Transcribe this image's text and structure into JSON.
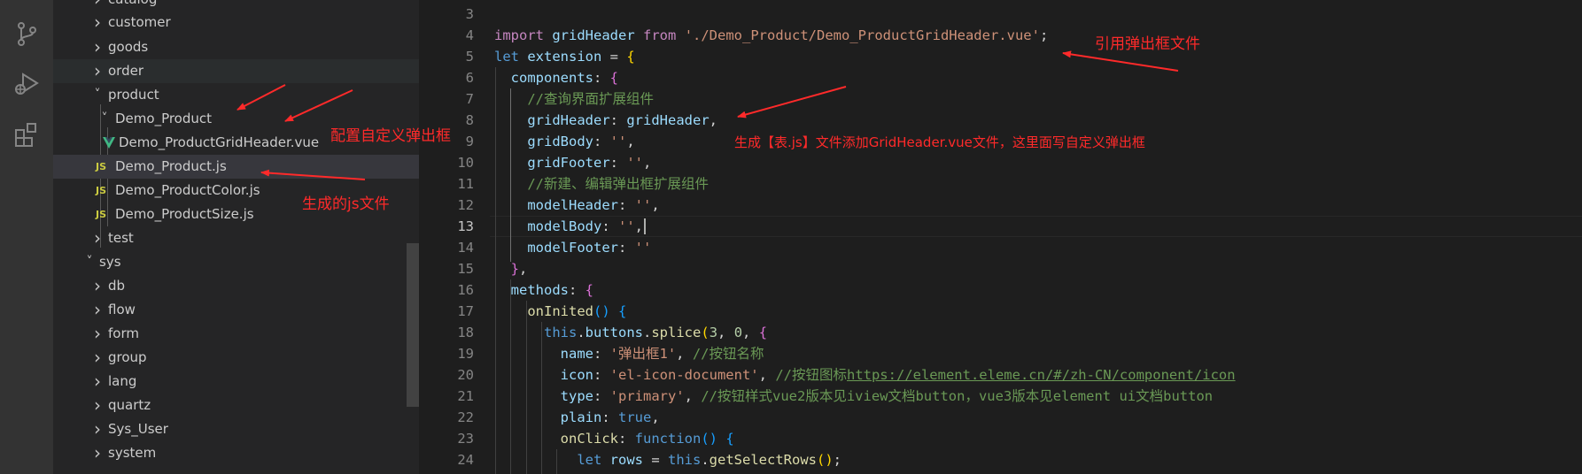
{
  "explorer": {
    "items": [
      {
        "label": "catalog",
        "type": "folder",
        "open": false
      },
      {
        "label": "customer",
        "type": "folder",
        "open": false
      },
      {
        "label": "goods",
        "type": "folder",
        "open": false
      },
      {
        "label": "order",
        "type": "folder",
        "open": false
      },
      {
        "label": "product",
        "type": "folder",
        "open": true
      },
      {
        "label": "Demo_Product",
        "type": "folder",
        "open": true
      },
      {
        "label": "Demo_ProductGridHeader.vue",
        "type": "vue"
      },
      {
        "label": "Demo_Product.js",
        "type": "js"
      },
      {
        "label": "Demo_ProductColor.js",
        "type": "js"
      },
      {
        "label": "Demo_ProductSize.js",
        "type": "js"
      },
      {
        "label": "test",
        "type": "folder",
        "open": false
      },
      {
        "label": "sys",
        "type": "folder",
        "open": true
      },
      {
        "label": "db",
        "type": "folder",
        "open": false
      },
      {
        "label": "flow",
        "type": "folder",
        "open": false
      },
      {
        "label": "form",
        "type": "folder",
        "open": false
      },
      {
        "label": "group",
        "type": "folder",
        "open": false
      },
      {
        "label": "lang",
        "type": "folder",
        "open": false
      },
      {
        "label": "quartz",
        "type": "folder",
        "open": false
      },
      {
        "label": "Sys_User",
        "type": "folder",
        "open": false
      },
      {
        "label": "system",
        "type": "folder",
        "open": false
      }
    ]
  },
  "icons": {
    "js_badge": "JS",
    "activity": [
      "source-control-icon",
      "run-debug-icon",
      "extensions-icon"
    ]
  },
  "editor": {
    "line_numbers": [
      "3",
      "4",
      "5",
      "6",
      "7",
      "8",
      "9",
      "10",
      "11",
      "12",
      "13",
      "14",
      "15",
      "16",
      "17",
      "18",
      "19",
      "20",
      "21",
      "22",
      "23",
      "24"
    ],
    "active_line": "13",
    "lines": [
      [],
      [
        [
          "kw-pink",
          "import"
        ],
        [
          "plain",
          " "
        ],
        [
          "id",
          "gridHeader"
        ],
        [
          "plain",
          " "
        ],
        [
          "kw-pink",
          "from"
        ],
        [
          "plain",
          " "
        ],
        [
          "str",
          "'./Demo_Product/Demo_ProductGridHeader.vue'"
        ],
        [
          "plain",
          ";"
        ]
      ],
      [
        [
          "kw-blue",
          "let"
        ],
        [
          "plain",
          " "
        ],
        [
          "id",
          "extension"
        ],
        [
          "plain",
          " = "
        ],
        [
          "br-y",
          "{"
        ]
      ],
      [
        [
          "plain",
          "  "
        ],
        [
          "id",
          "components"
        ],
        [
          "plain",
          ": "
        ],
        [
          "br-p",
          "{"
        ]
      ],
      [
        [
          "plain",
          "    "
        ],
        [
          "cmt",
          "//查询界面扩展组件"
        ]
      ],
      [
        [
          "plain",
          "    "
        ],
        [
          "id",
          "gridHeader"
        ],
        [
          "plain",
          ": "
        ],
        [
          "id",
          "gridHeader"
        ],
        [
          "plain",
          ","
        ]
      ],
      [
        [
          "plain",
          "    "
        ],
        [
          "id",
          "gridBody"
        ],
        [
          "plain",
          ": "
        ],
        [
          "str",
          "''"
        ],
        [
          "plain",
          ","
        ]
      ],
      [
        [
          "plain",
          "    "
        ],
        [
          "id",
          "gridFooter"
        ],
        [
          "plain",
          ": "
        ],
        [
          "str",
          "''"
        ],
        [
          "plain",
          ","
        ]
      ],
      [
        [
          "plain",
          "    "
        ],
        [
          "cmt",
          "//新建、编辑弹出框扩展组件"
        ]
      ],
      [
        [
          "plain",
          "    "
        ],
        [
          "id",
          "modelHeader"
        ],
        [
          "plain",
          ": "
        ],
        [
          "str",
          "''"
        ],
        [
          "plain",
          ","
        ]
      ],
      [
        [
          "plain",
          "    "
        ],
        [
          "id",
          "modelBody"
        ],
        [
          "plain",
          ": "
        ],
        [
          "str",
          "''"
        ],
        [
          "plain",
          ","
        ]
      ],
      [
        [
          "plain",
          "    "
        ],
        [
          "id",
          "modelFooter"
        ],
        [
          "plain",
          ": "
        ],
        [
          "str",
          "''"
        ]
      ],
      [
        [
          "plain",
          "  "
        ],
        [
          "br-p",
          "}"
        ],
        [
          "plain",
          ","
        ]
      ],
      [
        [
          "plain",
          "  "
        ],
        [
          "id",
          "methods"
        ],
        [
          "plain",
          ": "
        ],
        [
          "br-p",
          "{"
        ]
      ],
      [
        [
          "plain",
          "    "
        ],
        [
          "fn",
          "onInited"
        ],
        [
          "br-b",
          "()"
        ],
        [
          "plain",
          " "
        ],
        [
          "br-b",
          "{"
        ]
      ],
      [
        [
          "plain",
          "      "
        ],
        [
          "kw-blue",
          "this"
        ],
        [
          "plain",
          "."
        ],
        [
          "id",
          "buttons"
        ],
        [
          "plain",
          "."
        ],
        [
          "fn",
          "splice"
        ],
        [
          "br-y",
          "("
        ],
        [
          "num",
          "3"
        ],
        [
          "plain",
          ", "
        ],
        [
          "num",
          "0"
        ],
        [
          "plain",
          ", "
        ],
        [
          "br-p",
          "{"
        ]
      ],
      [
        [
          "plain",
          "        "
        ],
        [
          "id",
          "name"
        ],
        [
          "plain",
          ": "
        ],
        [
          "str",
          "'弹出框1'"
        ],
        [
          "plain",
          ", "
        ],
        [
          "cmt",
          "//按钮名称"
        ]
      ],
      [
        [
          "plain",
          "        "
        ],
        [
          "id",
          "icon"
        ],
        [
          "plain",
          ": "
        ],
        [
          "str",
          "'el-icon-document'"
        ],
        [
          "plain",
          ", "
        ],
        [
          "cmt",
          "//按钮图标"
        ],
        [
          "cmt link",
          "https://element.eleme.cn/#/zh-CN/component/icon"
        ]
      ],
      [
        [
          "plain",
          "        "
        ],
        [
          "id",
          "type"
        ],
        [
          "plain",
          ": "
        ],
        [
          "str",
          "'primary'"
        ],
        [
          "plain",
          ", "
        ],
        [
          "cmt",
          "//按钮样式vue2版本见iview文档button，vue3版本见element ui文档button"
        ]
      ],
      [
        [
          "plain",
          "        "
        ],
        [
          "id",
          "plain"
        ],
        [
          "plain",
          ": "
        ],
        [
          "kw-blue",
          "true"
        ],
        [
          "plain",
          ","
        ]
      ],
      [
        [
          "plain",
          "        "
        ],
        [
          "fn",
          "onClick"
        ],
        [
          "plain",
          ": "
        ],
        [
          "kw-blue",
          "function"
        ],
        [
          "br-b",
          "()"
        ],
        [
          "plain",
          " "
        ],
        [
          "br-b",
          "{"
        ]
      ],
      [
        [
          "plain",
          "          "
        ],
        [
          "kw-blue",
          "let"
        ],
        [
          "plain",
          " "
        ],
        [
          "id",
          "rows"
        ],
        [
          "plain",
          " = "
        ],
        [
          "kw-blue",
          "this"
        ],
        [
          "plain",
          "."
        ],
        [
          "fn",
          "getSelectRows"
        ],
        [
          "br-y",
          "()"
        ],
        [
          "plain",
          ";"
        ]
      ]
    ]
  },
  "annotations": {
    "import_popup_file": "引用弹出框文件",
    "config_custom_popup": "配置自定义弹出框",
    "generated_js_file": "生成的js文件",
    "add_gridheader_note": "生成【表.js】文件添加GridHeader.vue文件，这里面写自定义弹出框"
  },
  "colors": {
    "annotation_red": "#ff2a2a",
    "selection": "#37373d",
    "editor_bg": "#1e1e1e",
    "sidebar_bg": "#252526"
  }
}
